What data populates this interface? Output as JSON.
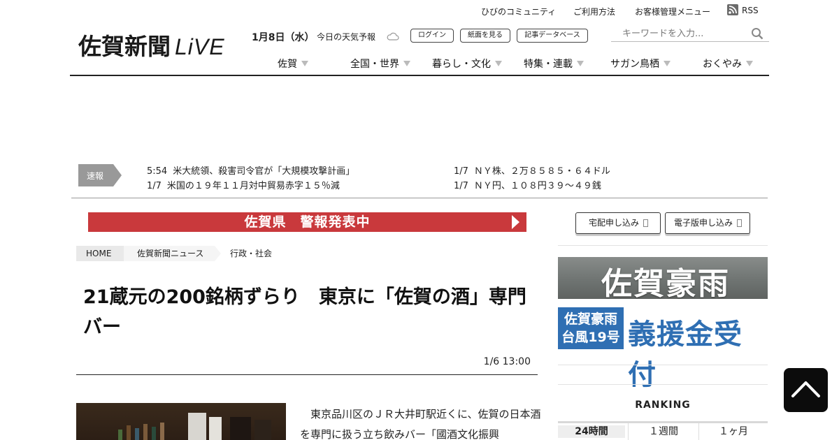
{
  "header": {
    "utility_links": [
      "ひびのコミュニティ",
      "ご利用方法",
      "お客様管理メニュー"
    ],
    "rss_label": "RSS",
    "logo_text_jp": "佐賀新聞",
    "logo_text_live": "LiVE",
    "date": "1月8日（水）",
    "weather_label": "今日の天気予報",
    "buttons": [
      "ログイン",
      "紙面を見る",
      "記事データベース"
    ],
    "search_placeholder": "キーワードを入力..."
  },
  "nav": [
    "佐賀",
    "全国・世界",
    "暮らし・文化",
    "特集・連載",
    "サガン鳥栖",
    "おくやみ"
  ],
  "breaking": {
    "label": "速報",
    "items": [
      {
        "time": "5:54",
        "text": "米大統領、殺害司令官が「大規模攻撃計画」"
      },
      {
        "time": "1/7",
        "text": "米国の１９年１１月対中貿易赤字１５％減"
      },
      {
        "time": "1/7",
        "text": "ＮＹ株、２万８５８５・６４ドル"
      },
      {
        "time": "1/7",
        "text": "ＮＹ円、１０８円３９～４９銭"
      }
    ]
  },
  "alert": {
    "text": "佐賀県　警報発表中"
  },
  "subscribe": {
    "delivery": "宅配申し込み",
    "digital": "電子版申し込み"
  },
  "breadcrumb": [
    "HOME",
    "佐賀新聞ニュース",
    "行政・社会"
  ],
  "article": {
    "headline": "21蔵元の200銘柄ずらり　東京に「佐賀の酒」専門バー",
    "date": "1/6 13:00",
    "body": "東京品川区のＪＲ大井町駅近くに、佐賀の日本酒を専門に扱う立ち飲みバー「國酒文化振興"
  },
  "sidebar": {
    "banner_rain": "佐賀豪雨",
    "banner_donate_left": [
      "佐賀豪雨",
      "台風19号"
    ],
    "banner_donate_right": "義援金受付",
    "ranking_title": "RANKING",
    "ranking_tabs": [
      "24時間",
      "１週間",
      "１ヶ月"
    ]
  },
  "colors": {
    "alert": "#c9393c",
    "donate_blue": "#2f6fb3",
    "sokuho_gray": "#999999"
  }
}
